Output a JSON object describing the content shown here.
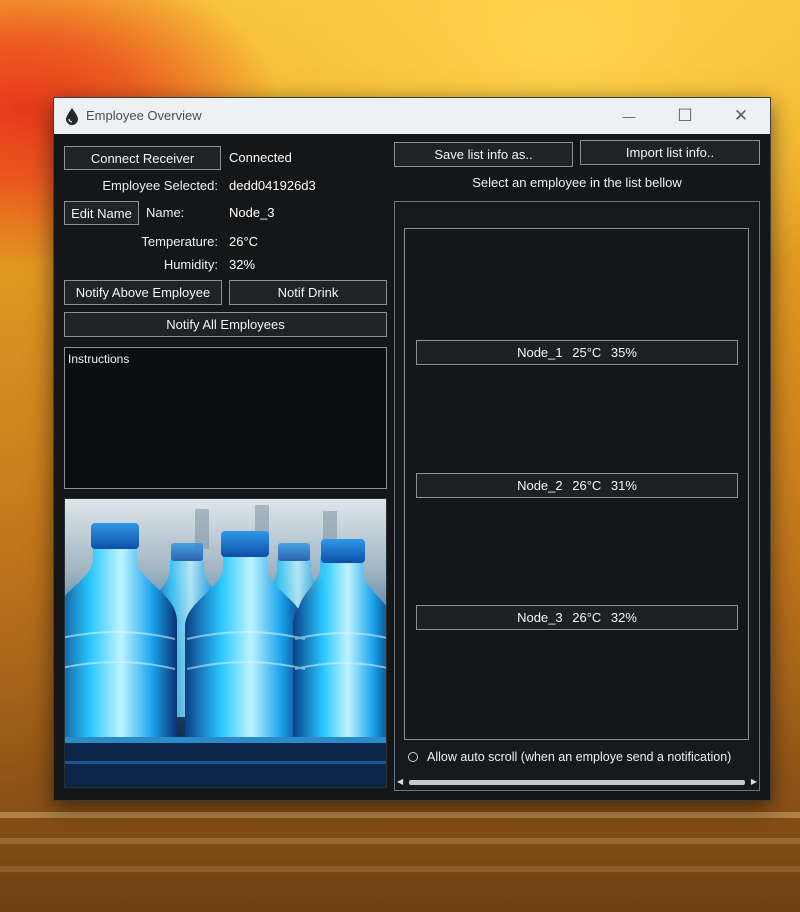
{
  "window": {
    "title": "Employee Overview",
    "controls": {
      "minimize": "—",
      "maximize": "☐",
      "close": "✕"
    }
  },
  "left": {
    "connect_button": "Connect Receiver",
    "connection_status": "Connected",
    "employee_selected_label": "Employee Selected:",
    "employee_selected_value": "dedd041926d3",
    "edit_name_button": "Edit Name",
    "name_label": "Name:",
    "name_value": "Node_3",
    "temperature_label": "Temperature:",
    "temperature_value": "26°C",
    "humidity_label": "Humidity:",
    "humidity_value": "32%",
    "notify_above_button": "Notify Above Employee",
    "notif_drink_button": "Notif Drink",
    "notify_all_button": "Notify All Employees",
    "instructions_label": "Instructions"
  },
  "right": {
    "save_button": "Save list info as..",
    "import_button": "Import list info..",
    "select_prompt": "Select an employee in the list bellow",
    "employees": [
      {
        "label": "Node_1  25°C  35%"
      },
      {
        "label": "Node_2  26°C  31%"
      },
      {
        "label": "Node_3  26°C  32%"
      }
    ],
    "auto_scroll_label": "Allow auto scroll (when an employe send a notification)"
  },
  "icons": [
    "water-drop-icon",
    "minimize-icon",
    "maximize-icon",
    "close-icon",
    "radio-icon",
    "scroll-left-icon",
    "scroll-right-icon"
  ],
  "colors": {
    "window_bg": "#141618",
    "border": "#8a9096",
    "bottle_blue": "#1ec8ff"
  }
}
